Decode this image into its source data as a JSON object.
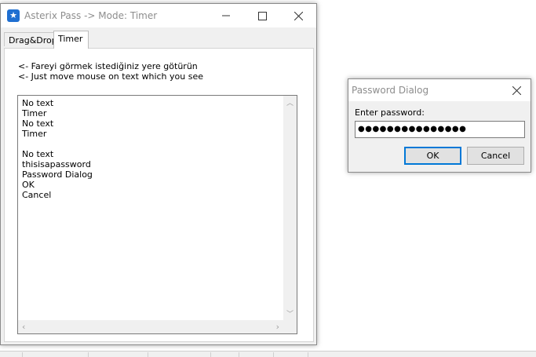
{
  "main_window": {
    "title": "Asterix Pass -> Mode: Timer",
    "tabs": [
      {
        "label": "Drag&Drop"
      },
      {
        "label": "Timer"
      }
    ],
    "hint_tr": "<- Fareyi görmek istediğiniz yere götürün",
    "hint_en": "<- Just move mouse on text which you see",
    "log_lines": [
      "No text",
      "Timer",
      "No text",
      "Timer",
      "",
      "No text",
      "thisisapassword",
      "Password Dialog",
      "OK",
      "Cancel"
    ]
  },
  "dialog": {
    "title": "Password Dialog",
    "prompt": "Enter password:",
    "password_mask": "●●●●●●●●●●●●●●●",
    "ok_label": "OK",
    "cancel_label": "Cancel"
  },
  "colors": {
    "accent": "#0078d7",
    "app_icon": "#1f6fd1",
    "title_text": "#8d8d8d"
  }
}
